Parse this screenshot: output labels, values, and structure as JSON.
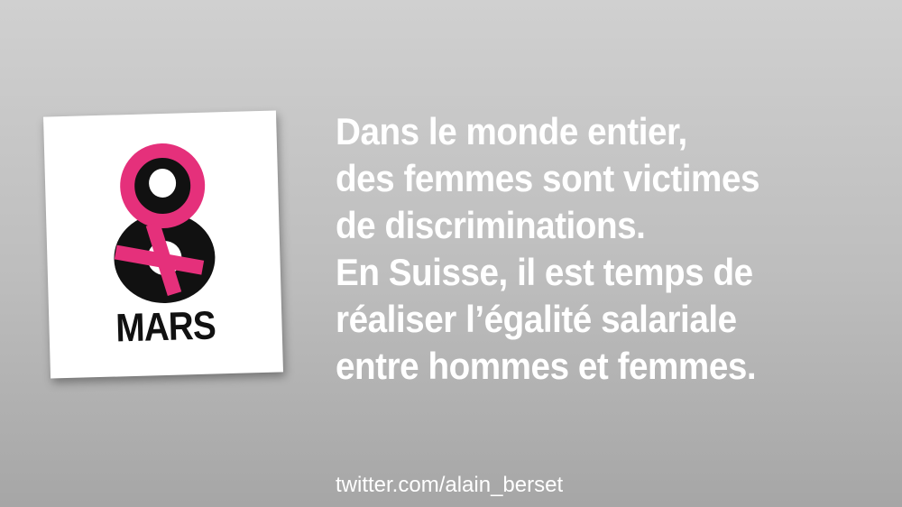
{
  "card": {
    "logo_icon": "eight-venus-symbol-icon",
    "month": "MARS"
  },
  "message": {
    "lines": [
      "Dans le monde entier,",
      "des femmes sont victimes",
      "de discriminations.",
      "En Suisse, il est temps de",
      "réaliser l’égalité salariale",
      "entre hommes et femmes."
    ]
  },
  "footer": {
    "handle": "twitter.com/alain_berset"
  },
  "colors": {
    "pink": "#e5307b",
    "black": "#111111",
    "text": "#ffffff"
  }
}
